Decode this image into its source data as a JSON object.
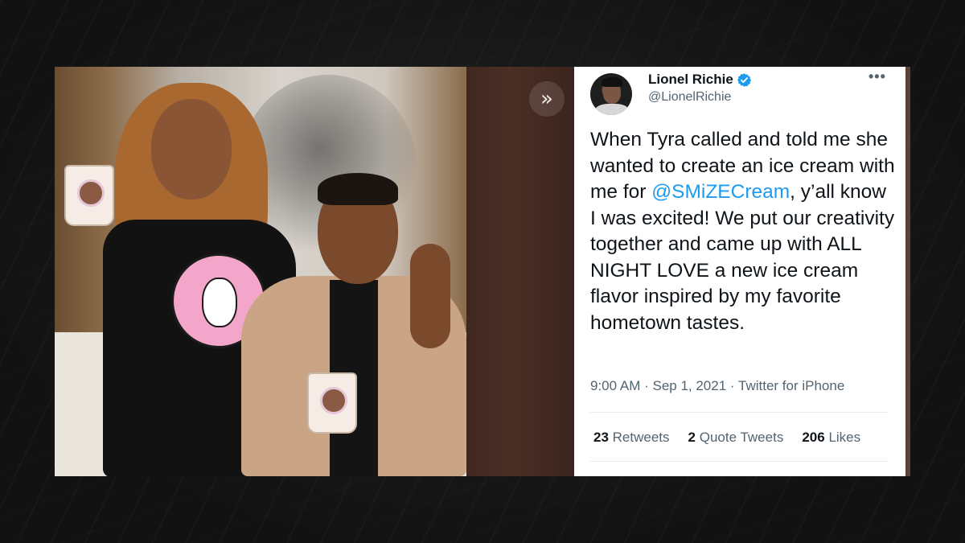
{
  "tweet": {
    "display_name": "Lionel Richie",
    "handle": "@LionelRichie",
    "text_part1": "When Tyra called and told me she wanted to create an ice cream with me for ",
    "mention": "@SMiZECream",
    "text_part2": ", y’all know I was excited! We put our creativity together and came up with ALL NIGHT LOVE a new ice cream flavor inspired by my favorite hometown tastes.",
    "time": "9:00 AM",
    "date": "Sep 1, 2021",
    "source": "Twitter for iPhone",
    "separator": " · ",
    "more_icon": "more-horizontal-icon",
    "verified_icon": "verified-badge-icon",
    "stats": {
      "retweets_count": "23",
      "retweets_label": "Retweets",
      "quotes_count": "2",
      "quotes_label": "Quote Tweets",
      "likes_count": "206",
      "likes_label": "Likes"
    }
  },
  "media_viewer": {
    "expand_icon": "chevron-double-right-icon",
    "expand_glyph": "»"
  },
  "colors": {
    "link": "#1d9bf0",
    "verified": "#1d9bf0",
    "text_primary": "#0f1419",
    "text_secondary": "#536471"
  }
}
